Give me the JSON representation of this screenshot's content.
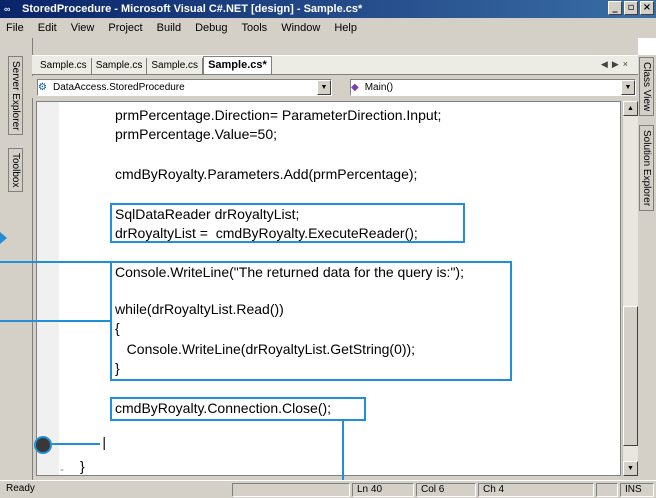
{
  "window": {
    "icon_glyph": "∞",
    "title": "StoredProcedure - Microsoft Visual C#.NET [design] - Sample.cs*",
    "buttons": {
      "minimize": "_",
      "maximize": "▫",
      "close": "×"
    }
  },
  "menu": [
    "File",
    "Edit",
    "View",
    "Project",
    "Build",
    "Debug",
    "Tools",
    "Window",
    "Help"
  ],
  "side_panels": {
    "left": [
      "Server Explorer",
      "Toolbox"
    ],
    "right": [
      "Class View",
      "Solution Explorer"
    ]
  },
  "tabs": [
    {
      "label": "Sample.cs",
      "active": false
    },
    {
      "label": "Sample.cs",
      "active": false
    },
    {
      "label": "Sample.cs",
      "active": false
    },
    {
      "label": "Sample.cs*",
      "active": true
    }
  ],
  "tab_nav": {
    "prev": "◀",
    "next": "▶",
    "close": "×"
  },
  "nav": {
    "class_combo": "DataAccess.StoredProcedure",
    "member_combo": "Main()"
  },
  "code": [
    "prmPercentage.Direction= ParameterDirection.Input;",
    "prmPercentage.Value=50;",
    "",
    "cmdByRoyalty.Parameters.Add(prmPercentage);",
    "",
    "SqlDataReader drRoyaltyList;",
    "drRoyaltyList =  cmdByRoyalty.ExecuteReader();",
    "",
    "Console.WriteLine(\"The returned data for the query is:\");",
    "",
    "while(drRoyaltyList.Read())",
    "{",
    "   Console.WriteLine(drRoyaltyList.GetString(0));",
    "}",
    "",
    "cmdByRoyalty.Connection.Close();"
  ],
  "editor_tail": {
    "caret": "|",
    "guide": "-",
    "closing_brace": "}"
  },
  "status": {
    "state": "Ready",
    "line": "Ln 40",
    "col": "Col 6",
    "ch": "Ch 4",
    "mode": "INS"
  },
  "colors": {
    "callout": "#1f8fd6",
    "title_start": "#0a246a",
    "title_end": "#3a6ea5"
  }
}
